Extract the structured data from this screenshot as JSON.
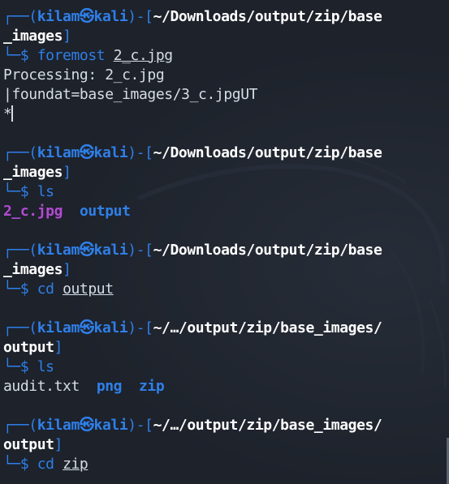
{
  "prompt": {
    "user": "kilam",
    "host": "kali",
    "at_symbol": "㉿"
  },
  "blocks": [
    {
      "path_line1": "~/Downloads/output/zip/base",
      "path_line2": "_images",
      "command": "foremost",
      "arg": "2_c.jpg",
      "output": {
        "line1": "Processing: 2_c.jpg",
        "line2_prefix": "|",
        "line2": "foundat=base_images/3_c.jpgUT",
        "line3": "*"
      }
    },
    {
      "path_line1": "~/Downloads/output/zip/base",
      "path_line2": "_images",
      "command": "ls",
      "output": {
        "file": "2_c.jpg",
        "dir": "output"
      }
    },
    {
      "path_line1": "~/Downloads/output/zip/base",
      "path_line2": "_images",
      "command": "cd",
      "arg": "output"
    },
    {
      "path_line1": "~/…/output/zip/base_images/",
      "path_line2": "output",
      "command": "ls",
      "output": {
        "file": "audit.txt",
        "dir1": "png",
        "dir2": "zip"
      }
    },
    {
      "path_line1": "~/…/output/zip/base_images/",
      "path_line2": "output",
      "command": "cd",
      "arg": "zip"
    }
  ],
  "glyphs": {
    "frame_top": "┌──(",
    "frame_mid": ")-[",
    "frame_close": "]",
    "frame_bottom": "└─",
    "dollar": "$"
  },
  "colors": {
    "background": "#1d222b",
    "prompt_blue": "#2f7fe8",
    "path_white": "#ffffff",
    "text": "#d6dde6",
    "image_file_purple": "#b34ad3"
  }
}
